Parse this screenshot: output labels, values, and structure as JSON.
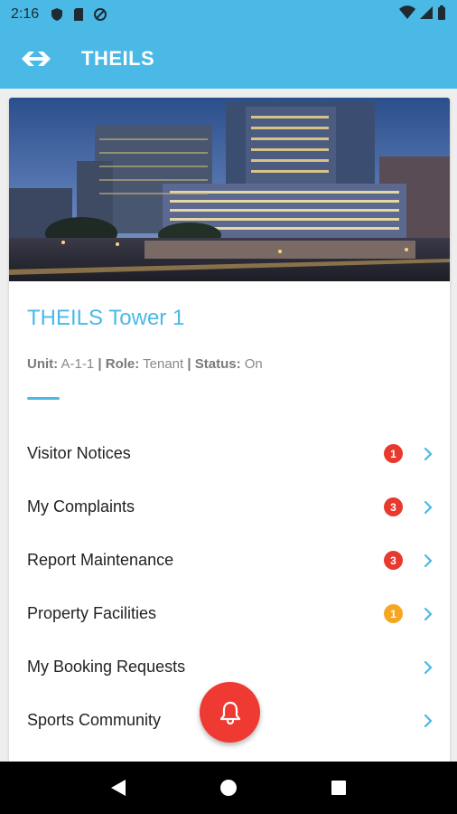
{
  "status_bar": {
    "time": "2:16"
  },
  "app_bar": {
    "title": "THEILS"
  },
  "property": {
    "name": "THEILS Tower 1",
    "unit_label": "Unit:",
    "unit_value": "A-1-1",
    "role_label": "Role:",
    "role_value": "Tenant",
    "status_label": "Status:",
    "status_value": "On",
    "separator": "|"
  },
  "menu": [
    {
      "label": "Visitor Notices",
      "badge": "1",
      "badge_color": "#e8392f"
    },
    {
      "label": "My Complaints",
      "badge": "3",
      "badge_color": "#e8392f"
    },
    {
      "label": "Report Maintenance",
      "badge": "3",
      "badge_color": "#e8392f"
    },
    {
      "label": "Property Facilities",
      "badge": "1",
      "badge_color": "#f5a623"
    },
    {
      "label": "My Booking Requests",
      "badge": ""
    },
    {
      "label": "Sports Community",
      "badge": ""
    }
  ],
  "fab": {
    "icon": "bell-icon"
  },
  "colors": {
    "primary": "#4ab9e6",
    "badge_red": "#e8392f",
    "badge_orange": "#f5a623",
    "fab": "#ef3a33"
  }
}
